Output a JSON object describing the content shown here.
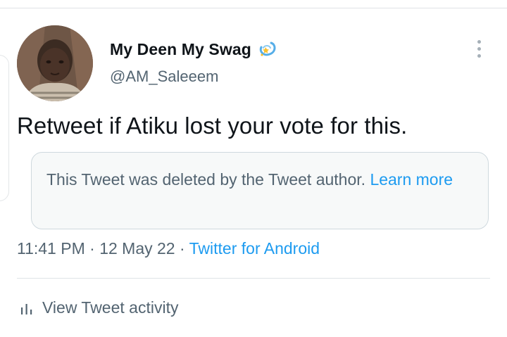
{
  "tweet": {
    "author": {
      "display_name": "My Deen My Swag",
      "handle": "@AM_Saleeem",
      "badge_emoji": "dizzy-emoji"
    },
    "text": "Retweet if Atiku lost your vote for this.",
    "quoted": {
      "deleted_message": "This Tweet was deleted by the Tweet author.",
      "link_label": "Learn more"
    },
    "meta": {
      "time": "11:41 PM",
      "separator": "·",
      "date": "12 May 22",
      "source": "Twitter for Android"
    },
    "activity_label": "View Tweet activity"
  },
  "colors": {
    "text": "#0f1419",
    "secondary": "#536471",
    "link": "#1d9bf0",
    "border": "#cfd9de",
    "divider": "#dfe3e6"
  }
}
